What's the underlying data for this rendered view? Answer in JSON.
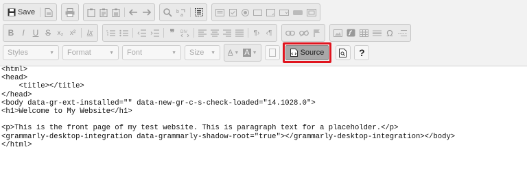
{
  "toolbar": {
    "save_label": "Save",
    "styles_label": "Styles",
    "format_label": "Format",
    "font_label": "Font",
    "size_label": "Size",
    "text_color_glyph": "A",
    "bg_color_glyph": "A",
    "source_label": "Source",
    "help_glyph": "?",
    "bold_glyph": "B",
    "italic_glyph": "I",
    "underline_glyph": "U",
    "strike_glyph": "S",
    "subscript_glyph": "x₂",
    "superscript_glyph": "x²",
    "removeformat_glyph": "Ix",
    "omega_glyph": "Ω",
    "colors": {
      "highlight_border": "#e0141e",
      "source_pressed": "#a8a8a8"
    }
  },
  "editor": {
    "lines": [
      "<html>",
      "<head>",
      "    <title></title>",
      "</head>",
      "<body data-gr-ext-installed=\"\" data-new-gr-c-s-check-loaded=\"14.1028.0\">",
      "<h1>Welcome to My Website</h1>",
      "",
      "<p>This is the front page of my test website. This is paragraph text for a placeholder.</p>",
      "<grammarly-desktop-integration data-grammarly-shadow-root=\"true\"></grammarly-desktop-integration></body>",
      "</html>"
    ]
  }
}
